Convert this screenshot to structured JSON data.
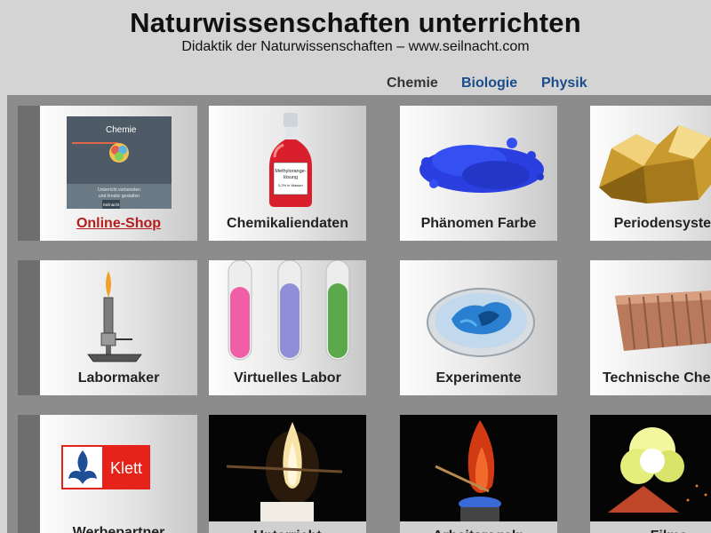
{
  "header": {
    "title": "Naturwissenschaften unterrichten",
    "subtitle": "Didaktik der Naturwissenschaften – www.seilnacht.com"
  },
  "nav": {
    "items": [
      {
        "label": "Chemie",
        "active": true
      },
      {
        "label": "Biologie",
        "active": false
      },
      {
        "label": "Physik",
        "active": false
      }
    ]
  },
  "book_cover": {
    "title": "Chemie",
    "tagline_1": "Unterricht vorbereiten",
    "tagline_2": "und kreativ gestalten",
    "publisher": "Seilnacht"
  },
  "bottle_label": {
    "line1": "Methylorange-",
    "line2": "lösung",
    "line3": "0,2% in Wasser"
  },
  "klett_logo": {
    "text": "Klett"
  },
  "tiles": [
    {
      "label": "Online-Shop"
    },
    {
      "label": "Chemikaliendaten"
    },
    {
      "label": "Phänomen Farbe"
    },
    {
      "label": "Periodensystem"
    },
    {
      "label": "Labormaker"
    },
    {
      "label": "Virtuelles Labor"
    },
    {
      "label": "Experimente"
    },
    {
      "label": "Technische Chemie"
    },
    {
      "label": "Werbepartner"
    },
    {
      "label": "Unterricht"
    },
    {
      "label": "Arbeitsregeln"
    },
    {
      "label": "Filme"
    }
  ],
  "colors": {
    "background": "#d4d4d4",
    "panel": "#8c8c8c",
    "nav_link": "#1a4d8a",
    "shop_link": "#b51d1d"
  }
}
